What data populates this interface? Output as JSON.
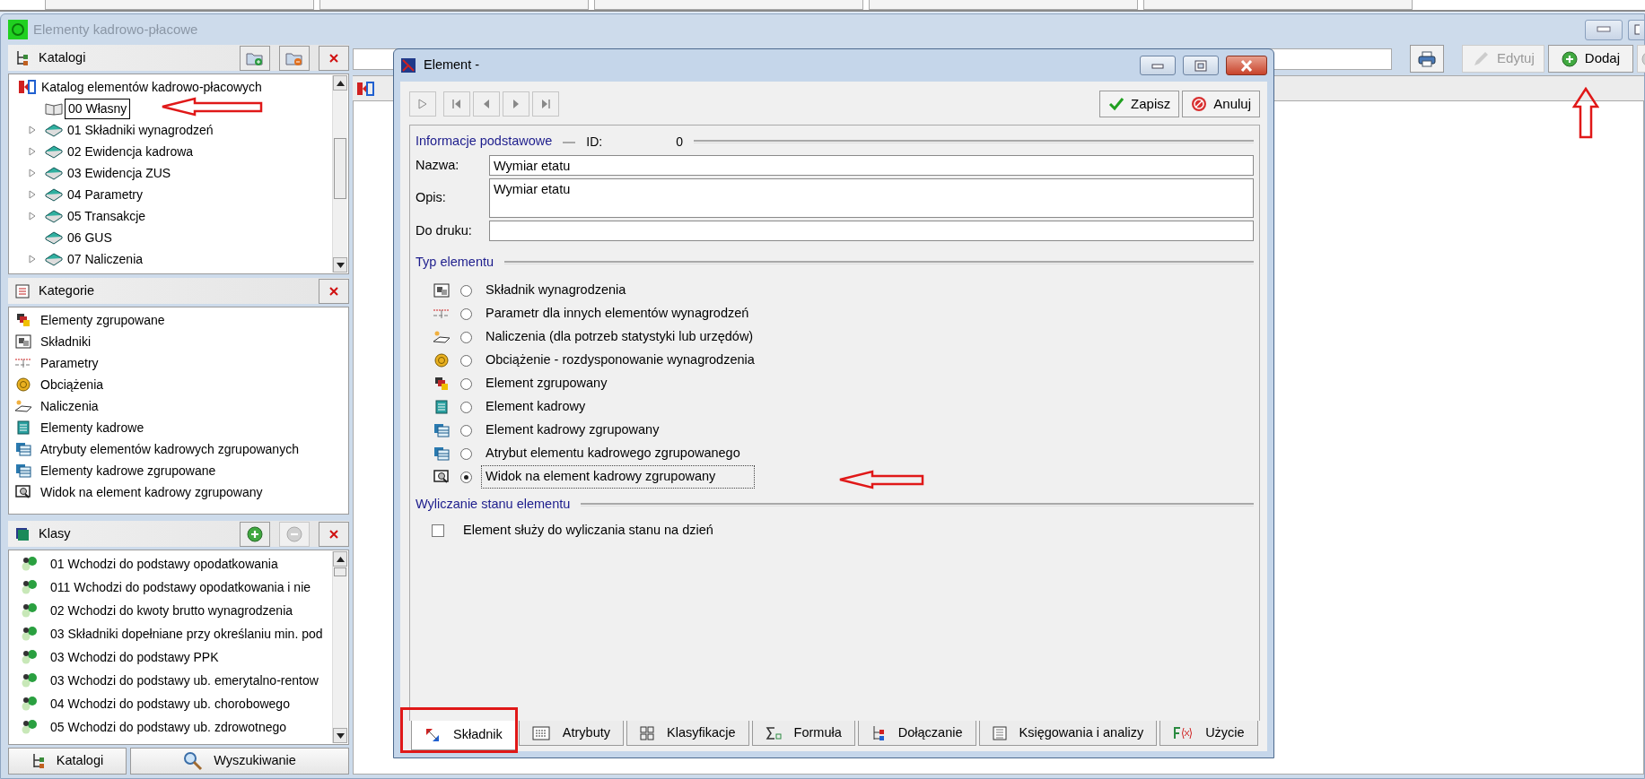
{
  "window": {
    "title": "Elementy kadrowo-płacowe"
  },
  "catalogs": {
    "title": "Katalogi",
    "buttons": [
      {
        "kind": "folder-add",
        "disabled": false
      },
      {
        "kind": "folder-remove",
        "disabled": false
      },
      {
        "kind": "close",
        "disabled": false
      }
    ],
    "tree": {
      "label": "Katalog elementów kadrowo-płacowych",
      "children": [
        {
          "label": "00 Własny",
          "kind": "open",
          "expandable": false,
          "selected": true
        },
        {
          "label": "01 Składniki wynagrodzeń",
          "kind": "closed",
          "expandable": true,
          "selected": false
        },
        {
          "label": "02 Ewidencja kadrowa",
          "kind": "closed",
          "expandable": true,
          "selected": false
        },
        {
          "label": "03 Ewidencja ZUS",
          "kind": "closed",
          "expandable": true,
          "selected": false
        },
        {
          "label": "04 Parametry",
          "kind": "closed",
          "expandable": true,
          "selected": false
        },
        {
          "label": "05 Transakcje",
          "kind": "closed",
          "expandable": true,
          "selected": false
        },
        {
          "label": "06 GUS",
          "kind": "closed",
          "expandable": false,
          "selected": false
        },
        {
          "label": "07 Naliczenia",
          "kind": "closed",
          "expandable": true,
          "selected": false
        }
      ]
    }
  },
  "categories": {
    "title": "Kategorie",
    "buttons": [
      {
        "kind": "close",
        "disabled": false
      }
    ],
    "items": [
      "Elementy zgrupowane",
      "Składniki",
      "Parametry",
      "Obciążenia",
      "Naliczenia",
      "Elementy kadrowe",
      "Atrybuty elementów kadrowych zgrupowanych",
      "Elementy kadrowe zgrupowane",
      "Widok na element kadrowy zgrupowany"
    ]
  },
  "classes": {
    "title": "Klasy",
    "buttons": [
      {
        "kind": "add",
        "disabled": false
      },
      {
        "kind": "remove",
        "disabled": true
      },
      {
        "kind": "close",
        "disabled": false
      }
    ],
    "items": [
      "01 Wchodzi do podstawy opodatkowania",
      "011 Wchodzi do podstawy opodatkowania i nie",
      "02 Wchodzi do kwoty brutto wynagrodzenia",
      "03 Składniki dopełniane przy określaniu min. pod",
      "03 Wchodzi do podstawy PPK",
      "03 Wchodzi do podstawy ub. emerytalno-rentow",
      "04 Wchodzi do podstawy ub. chorobowego",
      "05 Wchodzi do podstawy ub. zdrowotnego"
    ]
  },
  "bottom_buttons": [
    {
      "kind": "tree",
      "label": "Katalogi"
    },
    {
      "kind": "search",
      "label": "Wyszukiwanie"
    }
  ],
  "toolbar": {
    "buttons": [
      {
        "kind": "print",
        "disabled": false
      },
      {
        "kind": "edit",
        "label": "Edytuj",
        "disabled": true
      },
      {
        "kind": "add",
        "label": "Dodaj",
        "disabled": false
      },
      {
        "kind": "remove",
        "disabled": true
      }
    ]
  },
  "dialog": {
    "title": "Element -",
    "nav_buttons": [
      {
        "kind": "new"
      },
      {
        "kind": "first"
      },
      {
        "kind": "prev"
      },
      {
        "kind": "next"
      },
      {
        "kind": "last"
      }
    ],
    "actions": [
      {
        "kind": "save",
        "label": "Zapisz"
      },
      {
        "kind": "cancel",
        "label": "Anuluj"
      }
    ],
    "basic": {
      "title": "Informacje podstawowe",
      "id_label": "ID:",
      "id_value": "0",
      "fields": [
        {
          "label": "Nazwa:",
          "value": "Wymiar etatu",
          "kind": "line"
        },
        {
          "label": "Opis:",
          "value": "Wymiar etatu",
          "kind": "multiline"
        },
        {
          "label": "Do druku:",
          "kind": "line"
        }
      ]
    },
    "type": {
      "title": "Typ elementu",
      "options": [
        {
          "label": "Składnik wynagrodzenia",
          "selected": false
        },
        {
          "label": "Parametr dla innych elementów wynagrodzeń",
          "selected": false
        },
        {
          "label": "Naliczenia (dla potrzeb statystyki lub urzędów)",
          "selected": false
        },
        {
          "label": "Obciążenie - rozdysponowanie wynagrodzenia",
          "selected": false
        },
        {
          "label": "Element zgrupowany",
          "selected": false
        },
        {
          "label": "Element kadrowy",
          "selected": false
        },
        {
          "label": "Element kadrowy zgrupowany",
          "selected": false
        },
        {
          "label": "Atrybut elementu kadrowego zgrupowanego",
          "selected": false
        },
        {
          "label": "Widok na element kadrowy zgrupowany",
          "selected": true
        }
      ]
    },
    "state": {
      "title": "Wyliczanie stanu elementu",
      "checkbox": {
        "label": "Element służy do wyliczania stanu na dzień",
        "checked": false
      }
    },
    "tabs": [
      {
        "label": "Składnik",
        "selected": true
      },
      {
        "label": "Atrybuty",
        "selected": false
      },
      {
        "label": "Klasyfikacje",
        "selected": false
      },
      {
        "label": "Formuła",
        "selected": false
      },
      {
        "label": "Dołączanie",
        "selected": false
      },
      {
        "label": "Księgowania i analizy",
        "selected": false
      },
      {
        "label": "Użycie",
        "selected": false
      }
    ]
  }
}
